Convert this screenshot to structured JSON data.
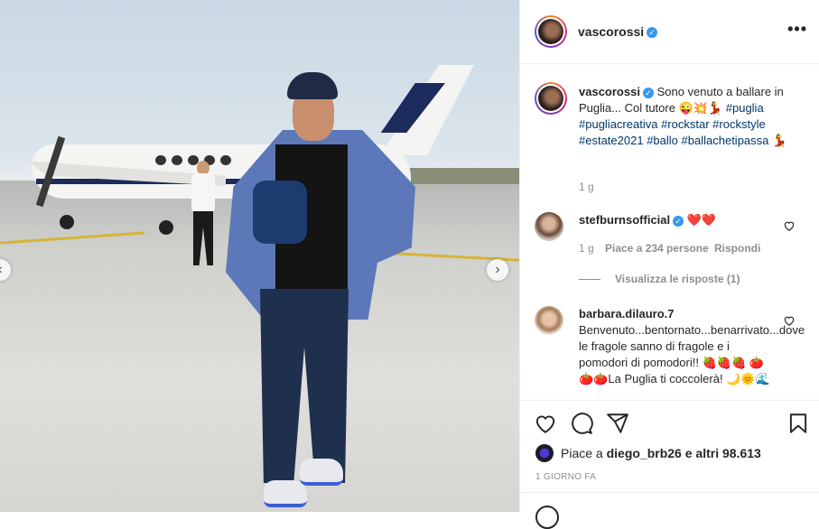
{
  "post": {
    "author": "vascorossi",
    "caption_text": "Sono venuto a ballare in Puglia... Col tutore 😜💥💃",
    "hashtags": [
      "#puglia",
      "#pugliacreativa",
      "#rockstar",
      "#rockstyle",
      "#estate2021",
      "#ballo",
      "#ballachetipassa"
    ],
    "caption_end_emoji": "💃",
    "caption_age": "1 g",
    "likes_prefix": "Piace a",
    "likes_user": "diego_brb26",
    "likes_suffix": "e altri 98.613",
    "posted": "1 GIORNO FA"
  },
  "comments": [
    {
      "user": "stefburnsofficial",
      "text": "❤️❤️",
      "age": "1 g",
      "likes": "Piace a 234 persone",
      "reply": "Rispondi",
      "view_replies": "Visualizza le risposte (1)"
    },
    {
      "user": "barbara.dilauro.7",
      "text": "Benvenuto...bentornato...benarrivato...dove le fragole sanno di fragole e i pomodori di pomodori!! 🍓🍓🍓 🍅🍅🍅La Puglia ti coccolerà! 🌙🌞🌊"
    }
  ],
  "icons": {
    "header_more": "more-options-icon",
    "verified": "verified-badge-icon",
    "like": "heart-icon",
    "comment": "comment-icon",
    "share": "paper-plane-icon",
    "save": "bookmark-icon",
    "carousel_prev": "chevron-left-icon",
    "carousel_next": "chevron-right-icon"
  },
  "colors": {
    "tag": "#00376b",
    "verified": "#3897f0",
    "muted": "#8e8e8e",
    "heart_red": "#ed4956"
  }
}
